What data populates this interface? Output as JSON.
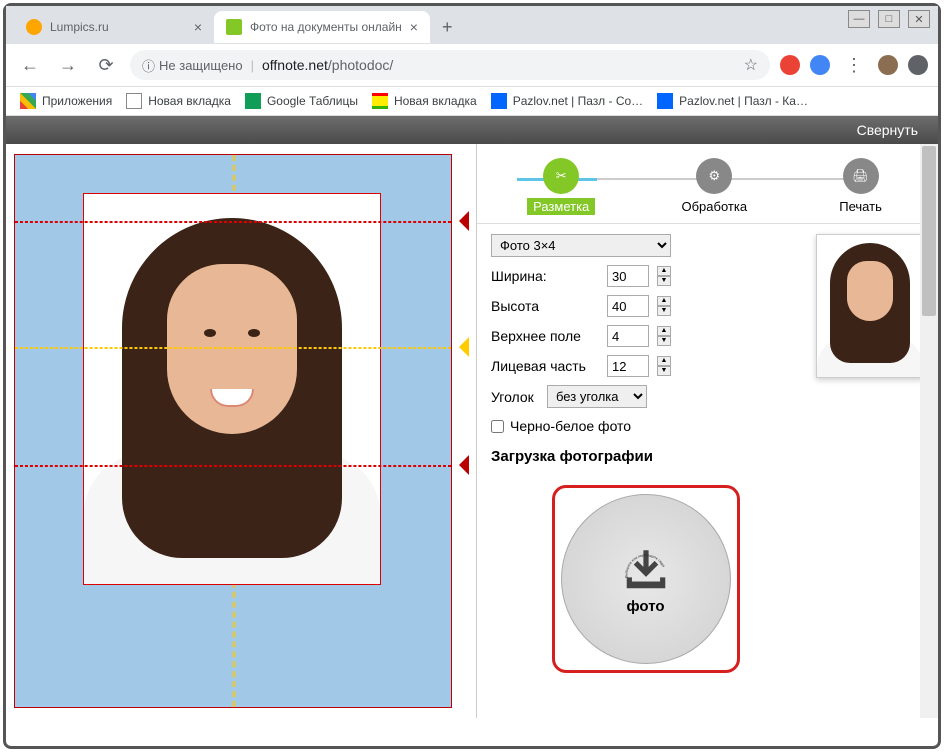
{
  "window": {
    "minimize": "—",
    "maximize": "□",
    "close": "✕"
  },
  "tabs": [
    {
      "title": "Lumpics.ru"
    },
    {
      "title": "Фото на документы онлайн"
    }
  ],
  "address": {
    "security": "Не защищено",
    "host": "offnote.net",
    "path": "/photodoc/"
  },
  "bookmarks": {
    "apps": "Приложения",
    "new_tab1": "Новая вкладка",
    "sheets": "Google Таблицы",
    "new_tab2": "Новая вкладка",
    "pazlov1": "Pazlov.net | Пазл - Со…",
    "pazlov2": "Pazlov.net | Пазл - Ка…"
  },
  "topbar": {
    "collapse": "Свернуть"
  },
  "steps": {
    "layout": "Разметка",
    "process": "Обработка",
    "print": "Печать"
  },
  "settings": {
    "preset": "Фото 3×4",
    "width_label": "Ширина:",
    "width_value": "30",
    "height_label": "Высота",
    "height_value": "40",
    "top_margin_label": "Верхнее поле",
    "top_margin_value": "4",
    "face_part_label": "Лицевая часть",
    "face_part_value": "12",
    "corner_label": "Уголок",
    "corner_value": "без уголка",
    "bw_label": "Черно-белое фото"
  },
  "upload": {
    "section_title": "Загрузка фотографии",
    "circle_hint": "Выберите или перетащите сюда",
    "circle_label": "фото"
  }
}
